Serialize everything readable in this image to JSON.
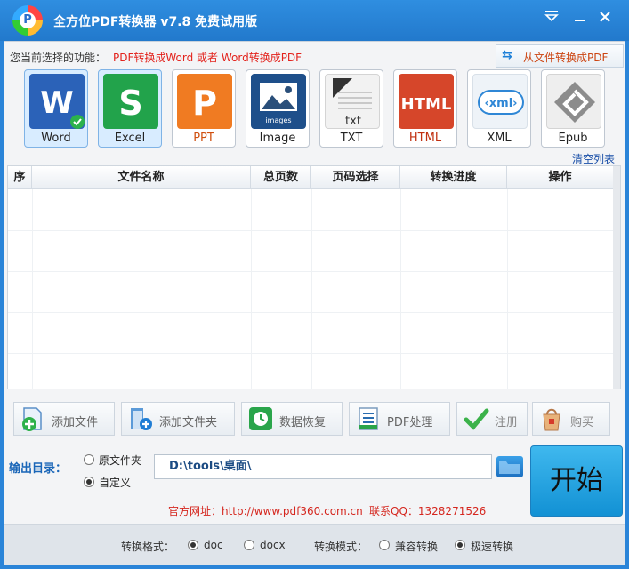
{
  "window": {
    "title": "全方位PDF转换器 v7.8 免费试用版",
    "logo_letter": "P"
  },
  "titlebar": {
    "menu_icon": "dropdown-icon",
    "minimize_icon": "minimize-icon",
    "close_icon": "close-icon"
  },
  "mode": {
    "current_label": "您当前选择的功能：",
    "current_value": "PDF转换成Word 或者 Word转换成PDF",
    "from_file_label": "从文件转换成PDF"
  },
  "formats": [
    {
      "label": "Word",
      "color": "#2b62b8"
    },
    {
      "label": "Excel",
      "color": "#22a34b"
    },
    {
      "label": "PPT",
      "color": "#f07b22"
    },
    {
      "label": "Image",
      "color": "#3c6fa8"
    },
    {
      "label": "TXT",
      "color": "#9a9a9a"
    },
    {
      "label": "HTML",
      "color": "#d6462a"
    },
    {
      "label": "XML",
      "color": "#2f87d6"
    },
    {
      "label": "Epub",
      "color": "#8c8c8c"
    }
  ],
  "list": {
    "clear_label": "清空列表",
    "columns": [
      "序",
      "文件名称",
      "总页数",
      "页码选择",
      "转换进度",
      "操作"
    ]
  },
  "toolbar": {
    "add_file": "添加文件",
    "add_folder": "添加文件夹",
    "data_recovery": "数据恢复",
    "pdf_process": "PDF处理",
    "register": "注册",
    "buy": "购买"
  },
  "output": {
    "label": "输出目录：",
    "option_original": "原文件夹",
    "option_custom": "自定义",
    "path": "D:\\tools\\桌面\\",
    "start_label": "开始"
  },
  "footer": {
    "site": "官方网址：http://www.pdf360.com.cn",
    "qq": "联系QQ：1328271526"
  },
  "bottom": {
    "format_label": "转换格式：",
    "format_doc": "doc",
    "format_docx": "docx",
    "mode_label": "转换模式：",
    "mode_compat": "兼容转换",
    "mode_fast": "极速转换"
  }
}
